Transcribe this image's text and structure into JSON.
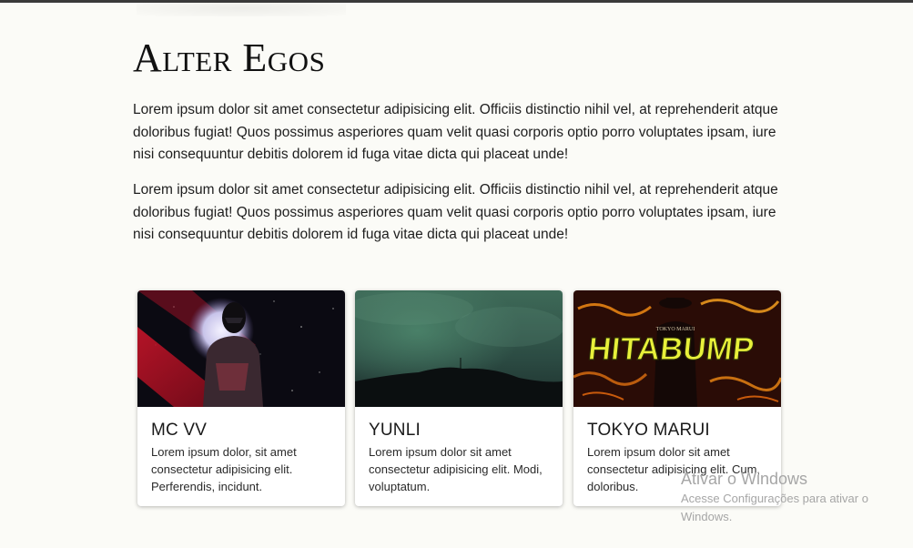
{
  "page": {
    "title": "Alter Egos",
    "paragraphs": [
      "Lorem ipsum dolor sit amet consectetur adipisicing elit. Officiis distinctio nihil vel, at reprehenderit atque doloribus fugiat! Quos possimus asperiores quam velit quasi corporis optio porro voluptates ipsam, iure nisi consequuntur debitis dolorem id fuga vitae dicta qui placeat unde!",
      "Lorem ipsum dolor sit amet consectetur adipisicing elit. Officiis distinctio nihil vel, at reprehenderit atque doloribus fugiat! Quos possimus asperiores quam velit quasi corporis optio porro voluptates ipsam, iure nisi consequuntur debitis dolorem id fuga vitae dicta qui placeat unde!"
    ]
  },
  "cards": [
    {
      "title": "MC VV",
      "description": "Lorem ipsum dolor, sit amet consectetur adipisicing elit. Perferendis, incidunt."
    },
    {
      "title": "YUNLI",
      "description": "Lorem ipsum dolor sit amet consectetur adipisicing elit. Modi, voluptatum."
    },
    {
      "title": "TOKYO MARUI",
      "description": "Lorem ipsum dolor sit amet consectetur adipisicing elit. Cum, doloribus.",
      "image_caption": "TOKYO MARUI",
      "image_text": "HITABUMP"
    }
  ],
  "watermark": {
    "title": "Ativar o Windows",
    "subtitle": "Acesse Configurações para ativar o Windows."
  },
  "colors": {
    "background": "#fbfbf7",
    "text": "#1c1c1c",
    "card_background": "#ffffff",
    "hitabump_yellow": "#e8f03a"
  }
}
